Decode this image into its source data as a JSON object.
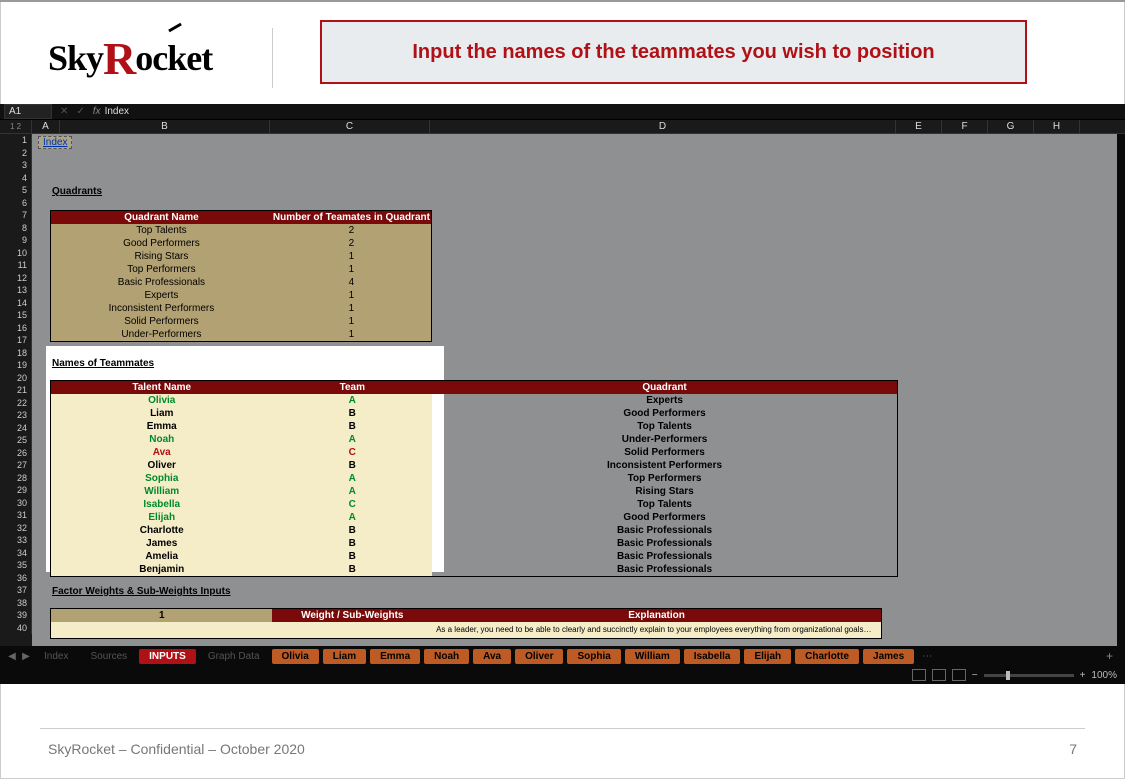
{
  "header": {
    "logo": "SkyRocket",
    "banner": "Input the names of the teammates you wish to position"
  },
  "app": {
    "namebox": "A1",
    "fx_value": "Index",
    "columns": [
      "A",
      "B",
      "C",
      "D",
      "E",
      "F",
      "G",
      "H"
    ],
    "index_link": "Index",
    "section_quadrants": "Quadrants",
    "section_names": "Names of Teammates",
    "section_factor": "Factor Weights & Sub-Weights Inputs",
    "quadrants_header": {
      "c1": "Quadrant Name",
      "c2": "Number of Teamates in Quadrant"
    },
    "quadrants": [
      {
        "name": "Top Talents",
        "count": "2"
      },
      {
        "name": "Good Performers",
        "count": "2"
      },
      {
        "name": "Rising Stars",
        "count": "1"
      },
      {
        "name": "Top Performers",
        "count": "1"
      },
      {
        "name": "Basic Professionals",
        "count": "4"
      },
      {
        "name": "Experts",
        "count": "1"
      },
      {
        "name": "Inconsistent Performers",
        "count": "1"
      },
      {
        "name": "Solid Performers",
        "count": "1"
      },
      {
        "name": "Under-Performers",
        "count": "1"
      }
    ],
    "names_header": {
      "c1": "Talent Name",
      "c2": "Team",
      "c3": "Quadrant"
    },
    "teammates": [
      {
        "name": "Olivia",
        "team": "A",
        "quadrant": "Experts",
        "style": "green"
      },
      {
        "name": "Liam",
        "team": "B",
        "quadrant": "Good Performers",
        "style": ""
      },
      {
        "name": "Emma",
        "team": "B",
        "quadrant": "Top Talents",
        "style": ""
      },
      {
        "name": "Noah",
        "team": "A",
        "quadrant": "Under-Performers",
        "style": "green"
      },
      {
        "name": "Ava",
        "team": "C",
        "quadrant": "Solid Performers",
        "style": "red"
      },
      {
        "name": "Oliver",
        "team": "B",
        "quadrant": "Inconsistent Performers",
        "style": ""
      },
      {
        "name": "Sophia",
        "team": "A",
        "quadrant": "Top Performers",
        "style": "green"
      },
      {
        "name": "William",
        "team": "A",
        "quadrant": "Rising Stars",
        "style": "green"
      },
      {
        "name": "Isabella",
        "team": "C",
        "quadrant": "Top Talents",
        "style": "green"
      },
      {
        "name": "Elijah",
        "team": "A",
        "quadrant": "Good Performers",
        "style": "green"
      },
      {
        "name": "Charlotte",
        "team": "B",
        "quadrant": "Basic Professionals",
        "style": ""
      },
      {
        "name": "James",
        "team": "B",
        "quadrant": "Basic Professionals",
        "style": ""
      },
      {
        "name": "Amelia",
        "team": "B",
        "quadrant": "Basic Professionals",
        "style": ""
      },
      {
        "name": "Benjamin",
        "team": "B",
        "quadrant": "Basic Professionals",
        "style": ""
      }
    ],
    "factor_header": {
      "c1": "1",
      "c2": "Weight / Sub-Weights",
      "c3": "Explanation"
    },
    "factor_text": "As a leader, you need to be able to clearly and succinctly explain to your employees everything from organizational goals…",
    "tabs": {
      "nav": [
        "Index",
        "Sources",
        "INPUTS",
        "Graph Data"
      ],
      "people": [
        "Olivia",
        "Liam",
        "Emma",
        "Noah",
        "Ava",
        "Oliver",
        "Sophia",
        "William",
        "Isabella",
        "Elijah",
        "Charlotte",
        "James"
      ]
    },
    "zoom": "100%"
  },
  "footer": {
    "left": "SkyRocket – Confidential – October 2020",
    "page": "7"
  }
}
